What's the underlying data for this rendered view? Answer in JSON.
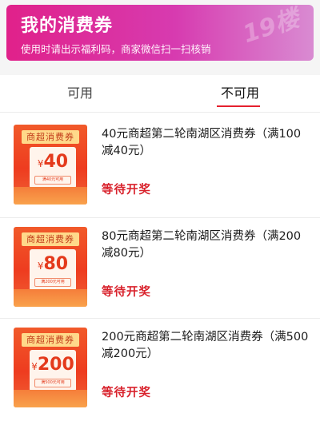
{
  "header": {
    "title": "我的消费券",
    "subtitle": "使用时请出示福利码，商家微信扫一扫核销",
    "watermark": "19楼"
  },
  "tabs": [
    {
      "label": "可用",
      "active": false
    },
    {
      "label": "不可用",
      "active": true
    }
  ],
  "coupons": [
    {
      "thumb_title": "商超消费券",
      "thumb_currency": "¥",
      "thumb_amount": "40",
      "thumb_condition": "满40元可用",
      "name": "40元商超第二轮南湖区消费券（满100减40元）",
      "status": "等待开奖"
    },
    {
      "thumb_title": "商超消费券",
      "thumb_currency": "¥",
      "thumb_amount": "80",
      "thumb_condition": "满200元可用",
      "name": "80元商超第二轮南湖区消费券（满200减80元）",
      "status": "等待开奖"
    },
    {
      "thumb_title": "商超消费券",
      "thumb_currency": "¥",
      "thumb_amount": "200",
      "thumb_condition": "满500元可用",
      "name": "200元商超第二轮南湖区消费券（满500减200元）",
      "status": "等待开奖"
    }
  ],
  "colors": {
    "accent": "#e5202e",
    "status": "#d9232d",
    "banner_start": "#e0218a",
    "banner_end": "#d98bd2"
  }
}
